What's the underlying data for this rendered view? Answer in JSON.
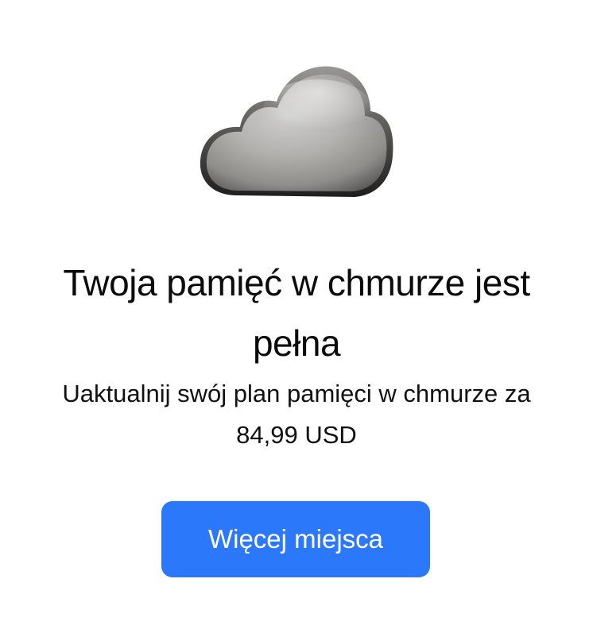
{
  "dialog": {
    "icon": "cloud-icon",
    "title": "Twoja pamięć w chmurze jest pełna",
    "subtitle": "Uaktualnij swój plan pamięci w chmurze za 84,99 USD",
    "cta_label": "Więcej miejsca"
  },
  "colors": {
    "accent": "#2b78fa",
    "background": "#ffffff",
    "text": "#0b0b0b"
  }
}
